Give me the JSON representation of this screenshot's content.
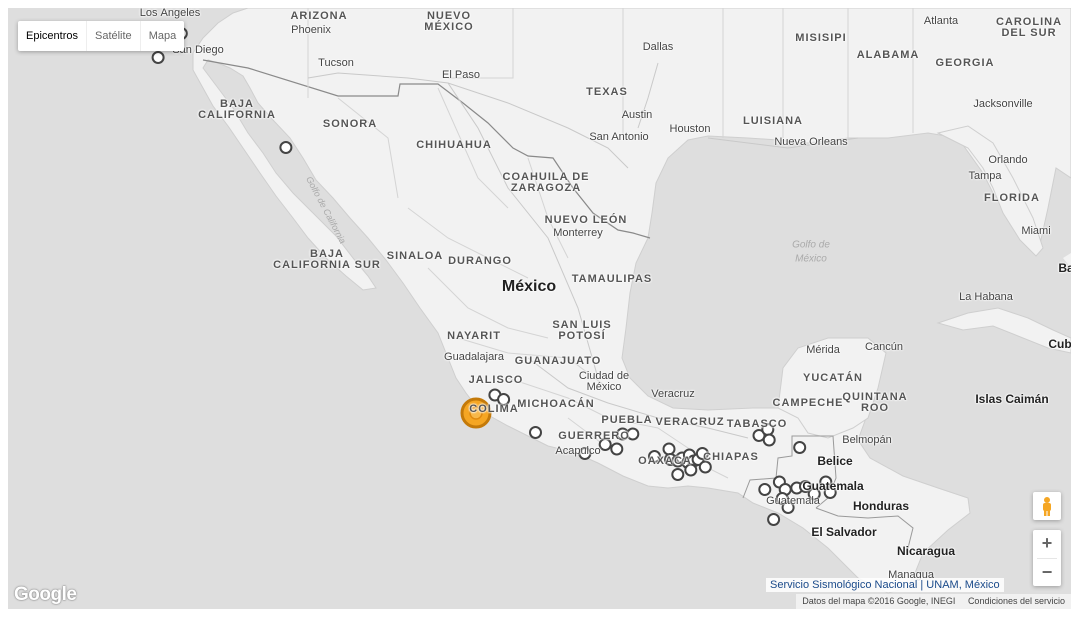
{
  "map_type": {
    "tabs": [
      "Epicentros",
      "Satélite",
      "Mapa"
    ],
    "active": "Epicentros"
  },
  "labels": {
    "big": [
      {
        "text": "México"
      }
    ],
    "country": [
      {
        "text": "Belice"
      },
      {
        "text": "Guatemala"
      },
      {
        "text": "Honduras"
      },
      {
        "text": "El Salvador"
      },
      {
        "text": "Nicaragua"
      },
      {
        "text": "Islas Caimán"
      },
      {
        "text": "Ba"
      },
      {
        "text": "Cub"
      }
    ],
    "state": [
      {
        "text": "ARIZONA"
      },
      {
        "text": "NUEVO"
      },
      {
        "text": "MÉXICO"
      },
      {
        "text": "MISISIPI"
      },
      {
        "text": "ALABAMA"
      },
      {
        "text": "GEORGIA"
      },
      {
        "text": "CAROLINA"
      },
      {
        "text": "DEL SUR"
      },
      {
        "text": "TEXAS"
      },
      {
        "text": "LUISIANA"
      },
      {
        "text": "FLORIDA"
      },
      {
        "text": "BAJA"
      },
      {
        "text": "CALIFORNIA"
      },
      {
        "text": "SONORA"
      },
      {
        "text": "CHIHUAHUA"
      },
      {
        "text": "COAHUILA DE"
      },
      {
        "text": "ZARAGOZA"
      },
      {
        "text": "NUEVO LEÓN"
      },
      {
        "text": "BAJA"
      },
      {
        "text": "CALIFORNIA SUR"
      },
      {
        "text": "SINALOA"
      },
      {
        "text": "DURANGO"
      },
      {
        "text": "TAMAULIPAS"
      },
      {
        "text": "NAYARIT"
      },
      {
        "text": "SAN LUIS"
      },
      {
        "text": "POTOSÍ"
      },
      {
        "text": "GUANAJUATO"
      },
      {
        "text": "JALISCO"
      },
      {
        "text": "YUCATÁN"
      },
      {
        "text": "CAMPECHE"
      },
      {
        "text": "QUINTANA"
      },
      {
        "text": "ROO"
      },
      {
        "text": "MICHOACÁN"
      },
      {
        "text": "PUEBLA"
      },
      {
        "text": "VERACRUZ"
      },
      {
        "text": "TABASCO"
      },
      {
        "text": "GUERRERO"
      },
      {
        "text": "OAXACA"
      },
      {
        "text": "CHIAPAS"
      },
      {
        "text": "COLIMA"
      }
    ],
    "city": [
      {
        "text": "Los Ángeles"
      },
      {
        "text": "San Diego"
      },
      {
        "text": "Phoenix"
      },
      {
        "text": "Tucson"
      },
      {
        "text": "El Paso"
      },
      {
        "text": "Dallas"
      },
      {
        "text": "Austin"
      },
      {
        "text": "San Antonio"
      },
      {
        "text": "Houston"
      },
      {
        "text": "Atlanta"
      },
      {
        "text": "Jacksonville"
      },
      {
        "text": "Nueva Orleans"
      },
      {
        "text": "Orlando"
      },
      {
        "text": "Tampa"
      },
      {
        "text": "Miami"
      },
      {
        "text": "La Habana"
      },
      {
        "text": "Monterrey"
      },
      {
        "text": "Guadalajara"
      },
      {
        "text": "Ciudad de"
      },
      {
        "text": "México"
      },
      {
        "text": "Veracruz"
      },
      {
        "text": "Mérida"
      },
      {
        "text": "Cancún"
      },
      {
        "text": "Belmopán"
      },
      {
        "text": "Acapulco"
      },
      {
        "text": "Guatemala"
      },
      {
        "text": "Managua"
      }
    ],
    "water": [
      {
        "text": "Golfo de"
      },
      {
        "text": "México"
      }
    ],
    "water2": [
      {
        "text": "Golfo de California"
      }
    ]
  },
  "epicenters": [
    {
      "lon": -116.1,
      "lat": 31.4
    },
    {
      "lon": -116.9,
      "lat": 30.6
    },
    {
      "lon": -112.5,
      "lat": 27.6
    },
    {
      "lon": -105.3,
      "lat": 19.35
    },
    {
      "lon": -105.0,
      "lat": 19.2
    },
    {
      "lon": -103.9,
      "lat": 18.1
    },
    {
      "lon": -102.2,
      "lat": 17.4
    },
    {
      "lon": -101.5,
      "lat": 17.7
    },
    {
      "lon": -101.1,
      "lat": 17.55
    },
    {
      "lon": -100.9,
      "lat": 18.05
    },
    {
      "lon": -100.55,
      "lat": 18.05
    },
    {
      "lon": -99.8,
      "lat": 17.3
    },
    {
      "lon": -99.3,
      "lat": 17.55
    },
    {
      "lon": -99.25,
      "lat": 17.2
    },
    {
      "lon": -99.0,
      "lat": 17.15
    },
    {
      "lon": -98.85,
      "lat": 17.25
    },
    {
      "lon": -98.65,
      "lat": 17.1
    },
    {
      "lon": -98.6,
      "lat": 17.35
    },
    {
      "lon": -98.45,
      "lat": 17.15
    },
    {
      "lon": -98.3,
      "lat": 17.2
    },
    {
      "lon": -98.15,
      "lat": 17.4
    },
    {
      "lon": -98.05,
      "lat": 16.95
    },
    {
      "lon": -98.55,
      "lat": 16.85
    },
    {
      "lon": -99.0,
      "lat": 16.7
    },
    {
      "lon": -96.2,
      "lat": 18.0
    },
    {
      "lon": -95.9,
      "lat": 18.2
    },
    {
      "lon": -95.85,
      "lat": 17.85
    },
    {
      "lon": -94.8,
      "lat": 17.6
    },
    {
      "lon": -96.0,
      "lat": 16.2
    },
    {
      "lon": -95.5,
      "lat": 16.45
    },
    {
      "lon": -95.3,
      "lat": 16.2
    },
    {
      "lon": -94.9,
      "lat": 16.25
    },
    {
      "lon": -94.6,
      "lat": 16.3
    },
    {
      "lon": -94.3,
      "lat": 16.05
    },
    {
      "lon": -93.75,
      "lat": 16.1
    },
    {
      "lon": -93.9,
      "lat": 16.45
    },
    {
      "lon": -95.4,
      "lat": 15.9
    },
    {
      "lon": -95.2,
      "lat": 15.6
    },
    {
      "lon": -95.7,
      "lat": 15.2
    }
  ],
  "main_event": {
    "lon": -105.95,
    "lat": 18.75
  },
  "credit": "Servicio Sismológico Nacional | UNAM, México",
  "footer": {
    "data": "Datos del mapa ©2016 Google, INEGI",
    "terms": "Condiciones del servicio"
  },
  "google_logo": "Google",
  "zoom": {
    "in": "+",
    "out": "−"
  },
  "colors": {
    "land": "#f2f2f2",
    "water": "#dedede",
    "border": "#9a9a9a",
    "main_event": "#f5a623",
    "main_event_ring": "#c47a0a",
    "epicenter_stroke": "#444444"
  }
}
